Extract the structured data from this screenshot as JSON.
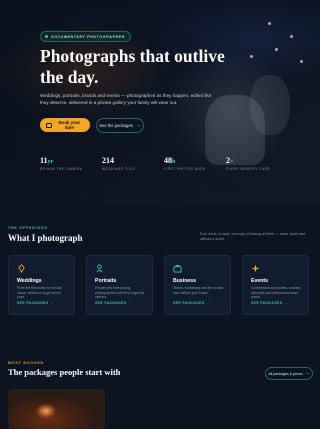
{
  "hero": {
    "badge": "DOCUMENTARY PHOTOGRAPHER",
    "title": "Photographs that outlive the day.",
    "subtitle": "Weddings, portraits, brands and events — photographed as they happen, edited like they deserve, delivered in a private gallery your family will wear out.",
    "primary_button": "Book your date",
    "secondary_button": "See the packages",
    "stats": [
      {
        "value": "11",
        "suffix": "yr",
        "label": "BEHIND THE CAMERA"
      },
      {
        "value": "214",
        "suffix": "",
        "label": "WEDDINGS TOLD"
      },
      {
        "value": "48",
        "suffix": "h",
        "label": "FIRST PHOTOS BACK"
      },
      {
        "value": "2",
        "suffix": "×",
        "label": "EVERY MEMORY CARD"
      }
    ]
  },
  "services": {
    "eyebrow": "THE OFFERINGS",
    "title": "What I photograph",
    "note": "Four kinds of days, one way of looking at them — close, quiet and without a script.",
    "cards": [
      {
        "icon": "rings-icon",
        "name": "Weddings",
        "desc": "From the first button to the last dance, without a single forced pose.",
        "link": "SEE PACKAGES"
      },
      {
        "icon": "person-icon",
        "name": "Portraits",
        "desc": "People who hate posing, photographed until they forget the camera.",
        "link": "SEE PACKAGES"
      },
      {
        "icon": "briefcase-icon",
        "name": "Business",
        "desc": "Teams, workshops and the honest work behind your brand.",
        "link": "SEE PACKAGES"
      },
      {
        "icon": "sparkle-icon",
        "name": "Events",
        "desc": "Conferences and parties, covered discreetly and delivered at news speed.",
        "link": "SEE PACKAGES"
      }
    ]
  },
  "packages": {
    "eyebrow": "MOST BOOKED",
    "title": "The packages people start with",
    "button": "All packages & prices"
  },
  "colors": {
    "accent": "#35d0b0",
    "primary_button": "#f2a623",
    "background": "#0b1220"
  }
}
